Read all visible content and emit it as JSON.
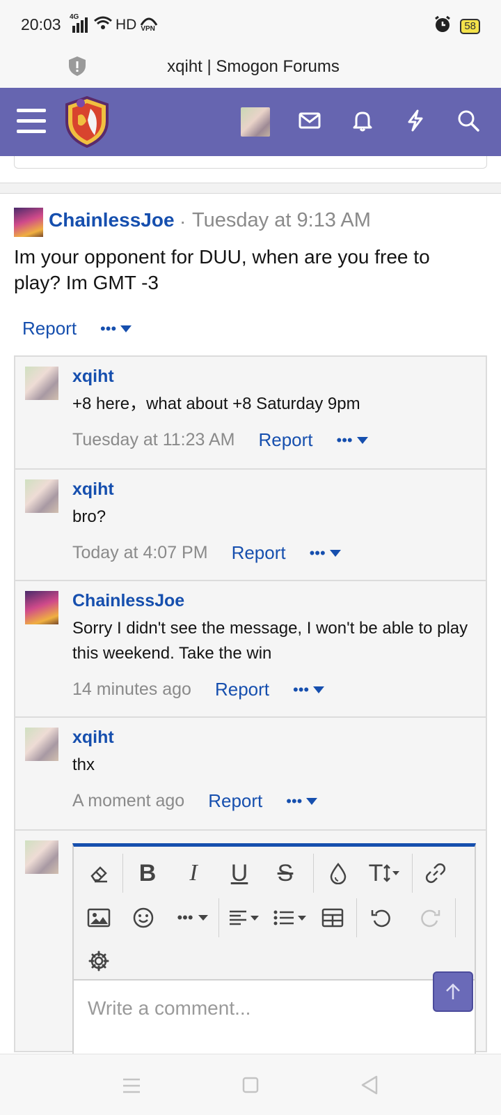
{
  "status_bar": {
    "time": "20:03",
    "network": "4G",
    "hd": "HD",
    "vpn": "VPN",
    "battery": "58"
  },
  "browser": {
    "page_title": "xqiht | Smogon Forums"
  },
  "nav": {
    "icons": [
      "menu-icon",
      "smogon-logo",
      "avatar",
      "mail-icon",
      "bell-icon",
      "lightning-icon",
      "search-icon"
    ],
    "color": "#6665b0"
  },
  "post": {
    "author": "ChainlessJoe",
    "separator": "·",
    "time": "Tuesday at 9:13 AM",
    "body": "Im your opponent for DUU, when are you free to play? Im GMT -3",
    "report_label": "Report",
    "more_label": "•••"
  },
  "comments": [
    {
      "author": "xqiht",
      "text": "+8 here，what about +8 Saturday 9pm",
      "time": "Tuesday at 11:23 AM",
      "report_label": "Report",
      "more_label": "•••"
    },
    {
      "author": "xqiht",
      "text": "bro?",
      "time": "Today at 4:07 PM",
      "report_label": "Report",
      "more_label": "•••"
    },
    {
      "author": "ChainlessJoe",
      "text": "Sorry I didn't see the message, I won't be able to play this weekend. Take the win",
      "time": "14 minutes ago",
      "report_label": "Report",
      "more_label": "•••"
    },
    {
      "author": "xqiht",
      "text": "thx",
      "time": "A moment ago",
      "report_label": "Report",
      "more_label": "•••"
    }
  ],
  "editor": {
    "toolbar": [
      "eraser-icon",
      "bold-icon",
      "italic-icon",
      "underline-icon",
      "strikethrough-icon",
      "color-drop-icon",
      "text-size-icon",
      "link-icon",
      "image-icon",
      "emoji-icon",
      "more-icon",
      "align-icon",
      "list-icon",
      "table-icon",
      "undo-icon",
      "redo-icon",
      "settings-icon"
    ],
    "bold": "B",
    "italic": "I",
    "underline": "U",
    "strike": "S",
    "text_size": "T",
    "more": "•••",
    "placeholder": "Write a comment..."
  },
  "colors": {
    "link": "#164fae",
    "muted": "#8a8a8a",
    "accent": "#6665b0"
  }
}
